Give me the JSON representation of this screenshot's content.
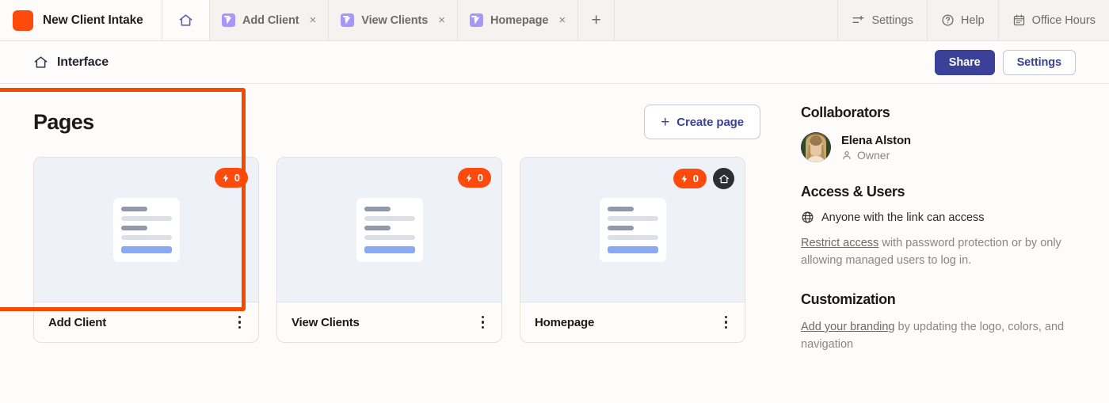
{
  "app": {
    "brand_title": "New Client Intake",
    "logo_color": "#ff4a0d"
  },
  "tabs": {
    "home_tab_name": "home-tab",
    "items": [
      {
        "label": "Add Client",
        "close": "×"
      },
      {
        "label": "View Clients",
        "close": "×"
      },
      {
        "label": "Homepage",
        "close": "×"
      }
    ],
    "add_tab_label": "+"
  },
  "topbar_actions": [
    {
      "label": "Settings",
      "icon": "sliders-icon"
    },
    {
      "label": "Help",
      "icon": "question-circle-icon"
    },
    {
      "label": "Office Hours",
      "icon": "calendar-icon"
    }
  ],
  "subheader": {
    "breadcrumb_label": "Interface",
    "share_label": "Share",
    "settings_label": "Settings",
    "primary_color": "#3b4198"
  },
  "main": {
    "pages_title": "Pages",
    "create_page_label": "Create page",
    "create_page_plus": "+",
    "highlight_color": "#f54900",
    "cards": [
      {
        "name": "Add Client",
        "runs": "0",
        "is_home": false,
        "selected": true
      },
      {
        "name": "View Clients",
        "runs": "0",
        "is_home": false,
        "selected": false
      },
      {
        "name": "Homepage",
        "runs": "0",
        "is_home": true,
        "selected": false
      }
    ]
  },
  "sidebar": {
    "collaborators_title": "Collaborators",
    "collaborator": {
      "name": "Elena Alston",
      "role": "Owner"
    },
    "access_title": "Access & Users",
    "access_line": "Anyone with the link can access",
    "restrict_link": "Restrict access",
    "restrict_rest": " with password protection or by only allowing managed users to log in.",
    "customization_title": "Customization",
    "branding_link": "Add your branding",
    "branding_rest": " by updating the logo, colors, and navigation"
  }
}
